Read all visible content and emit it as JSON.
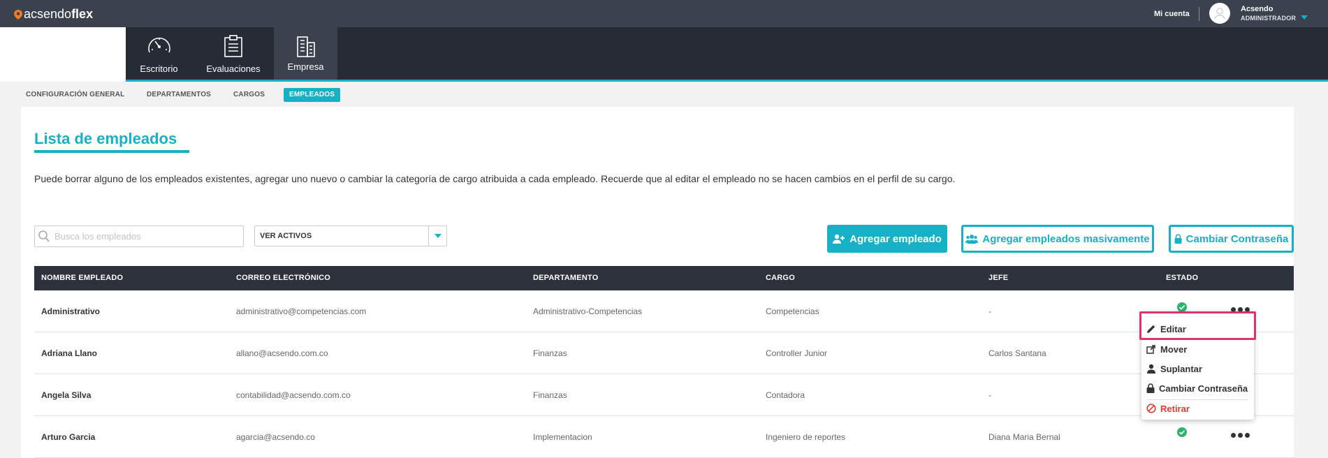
{
  "brand": {
    "logo_prefix": "acsendo",
    "logo_suffix": "flex"
  },
  "topbar": {
    "account_label": "Mi cuenta",
    "user_name": "Acsendo",
    "user_role": "ADMINISTRADOR"
  },
  "nav": {
    "items": [
      {
        "label": "Escritorio",
        "icon": "speedometer-icon"
      },
      {
        "label": "Evaluaciones",
        "icon": "clipboard-icon"
      },
      {
        "label": "Empresa",
        "icon": "building-icon",
        "active": true
      }
    ]
  },
  "subnav": {
    "tabs": [
      {
        "label": "CONFIGURACIÓN GENERAL"
      },
      {
        "label": "DEPARTAMENTOS"
      },
      {
        "label": "CARGOS"
      },
      {
        "label": "EMPLEADOS",
        "active": true
      }
    ]
  },
  "page": {
    "title": "Lista de empleados",
    "description": "Puede borrar alguno de los empleados existentes, agregar uno nuevo o cambiar la categoría de cargo atribuida a cada empleado. Recuerde que al editar el empleado no se hacen cambios en el perfil de su cargo."
  },
  "search": {
    "placeholder": "Busca los empleados",
    "value": ""
  },
  "filter": {
    "selected": "VER ACTIVOS"
  },
  "actions": {
    "add": "Agregar empleado",
    "add_bulk": "Agregar empleados masivamente",
    "change_password": "Cambiar Contraseña"
  },
  "table": {
    "headers": [
      "NOMBRE EMPLEADO",
      "CORREO ELECTRÓNICO",
      "DEPARTAMENTO",
      "CARGO",
      "JEFE",
      "ESTADO"
    ],
    "rows": [
      {
        "name": "Administrativo",
        "email": "administrativo@competencias.com",
        "department": "Administrativo-Competencias",
        "position": "Competencias",
        "boss": "-",
        "status": "active"
      },
      {
        "name": "Adriana Llano",
        "email": "allano@acsendo.com.co",
        "department": "Finanzas",
        "position": "Controller Junior",
        "boss": "Carlos Santana",
        "status": "active"
      },
      {
        "name": "Angela Silva",
        "email": "contabilidad@acsendo.com.co",
        "department": "Finanzas",
        "position": "Contadora",
        "boss": "-",
        "status": "active"
      },
      {
        "name": "Arturo Garcia",
        "email": "agarcia@acsendo.co",
        "department": "Implementacion",
        "position": "Ingeniero de reportes",
        "boss": "Diana Maria Bernal",
        "status": "active"
      }
    ]
  },
  "context_menu": {
    "items": [
      {
        "label": "Editar",
        "icon": "pencil-icon"
      },
      {
        "label": "Mover",
        "icon": "move-icon"
      },
      {
        "label": "Suplantar",
        "icon": "user-icon"
      },
      {
        "label": "Cambiar Contraseña",
        "icon": "lock-icon"
      },
      {
        "label": "Retirar",
        "icon": "ban-icon",
        "danger": true
      }
    ]
  },
  "colors": {
    "accent": "#16b1c7",
    "topbar": "#3b414d",
    "navbar": "#262b35",
    "table_header": "#2c313b",
    "status_ok": "#2db36b",
    "danger": "#e53935",
    "highlight": "#e0336e"
  }
}
